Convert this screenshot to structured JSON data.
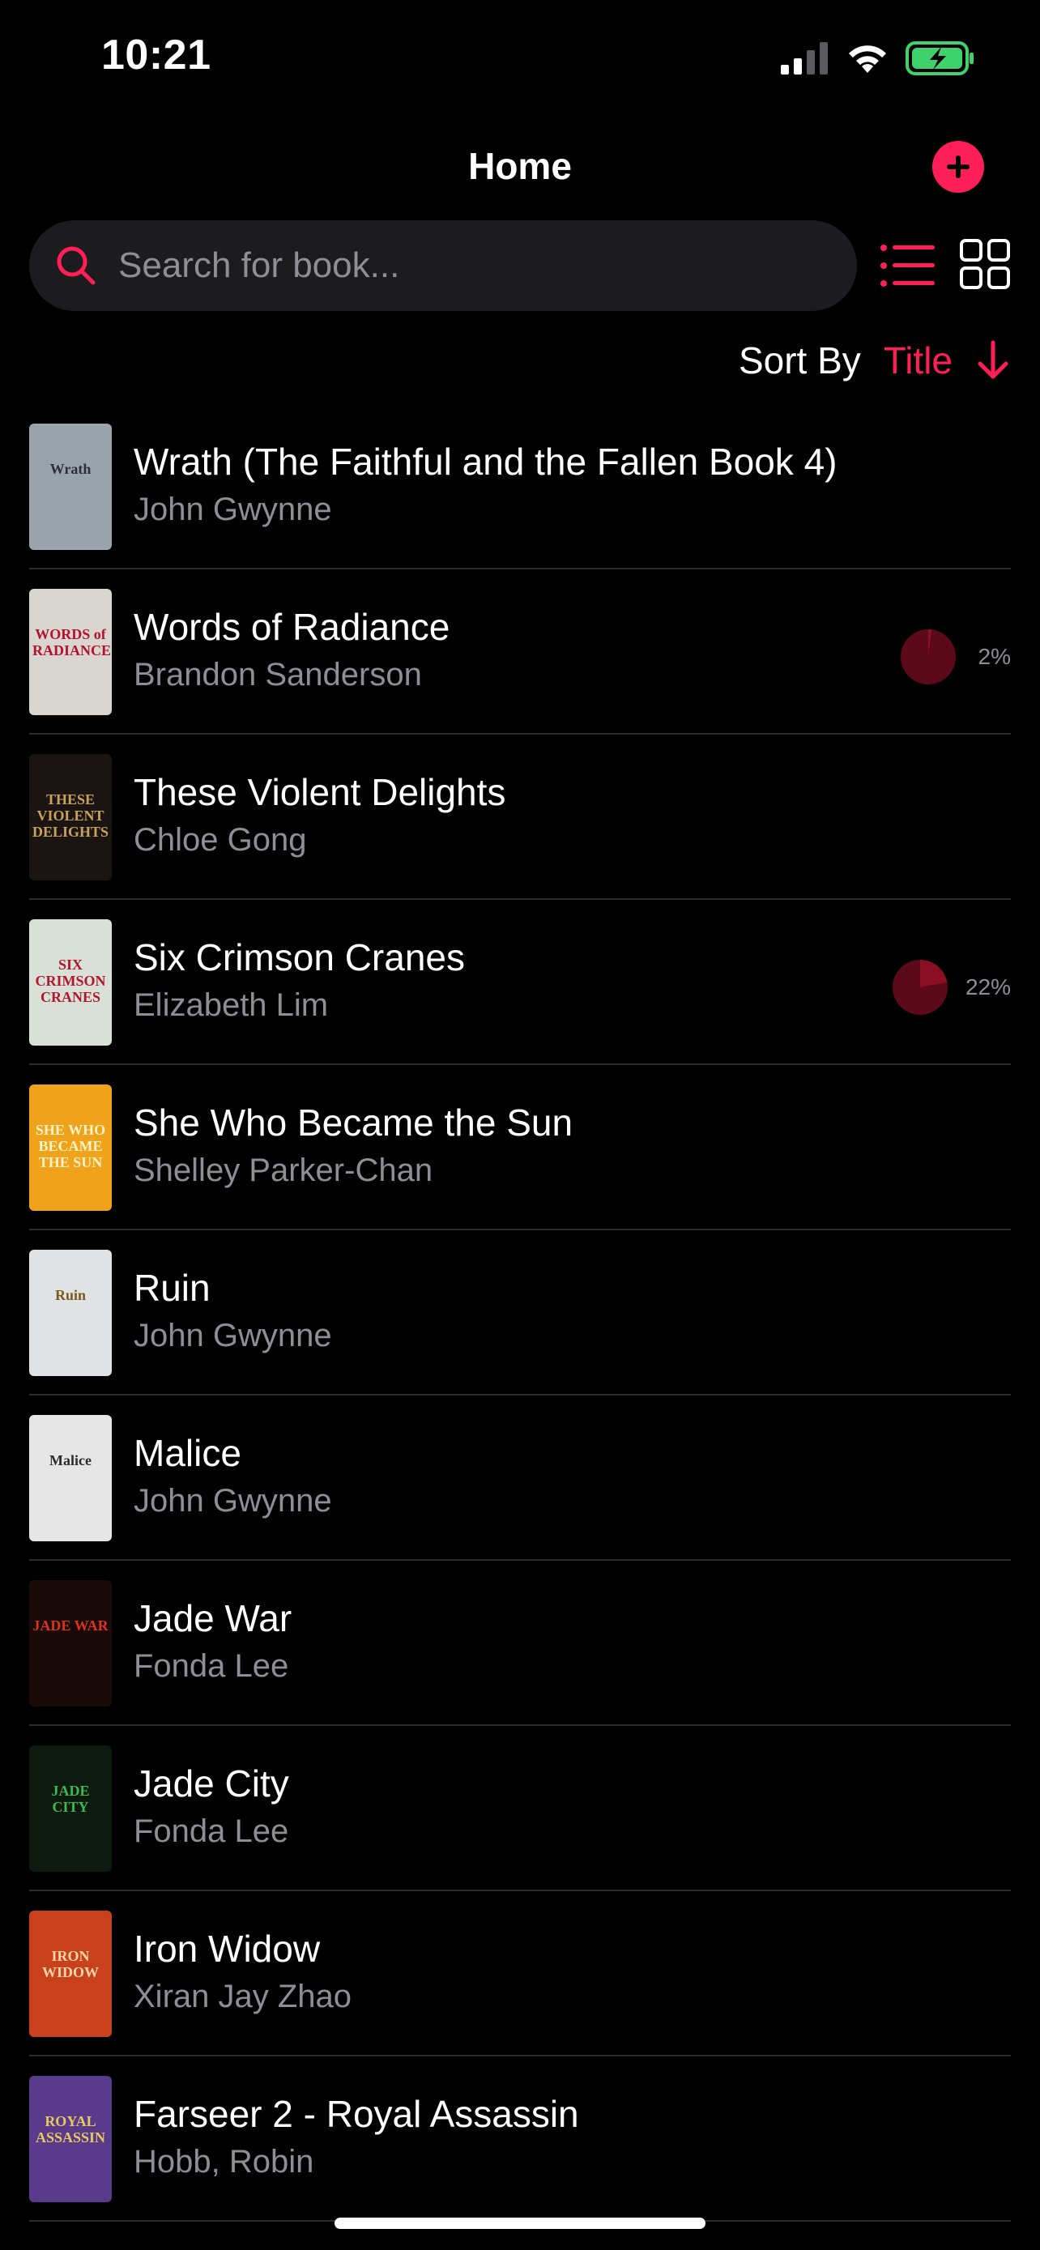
{
  "status_bar": {
    "time": "10:21",
    "icons": [
      "cellular-signal-icon",
      "wifi-icon",
      "battery-charging-icon"
    ]
  },
  "header": {
    "title": "Home",
    "add_icon": "plus-icon"
  },
  "search": {
    "placeholder": "Search for book...",
    "value": ""
  },
  "view_toggle": {
    "list_icon": "list-view-icon",
    "grid_icon": "grid-view-icon",
    "active": "list"
  },
  "sort": {
    "label": "Sort By",
    "value": "Title",
    "direction_icon": "arrow-down-icon"
  },
  "colors": {
    "accent": "#ff1f56",
    "progress_fill": "#8a0f24",
    "progress_track": "#5c0a1a",
    "secondary_text": "#8e8e93",
    "separator": "#2c2c2e"
  },
  "books": [
    {
      "title": "Wrath (The Faithful and the Fallen Book 4)",
      "author": "John Gwynne",
      "progress": null,
      "cover_text": "Wrath",
      "cover_bg": "#9aa3ab",
      "cover_fg": "#2a2f36"
    },
    {
      "title": "Words of Radiance",
      "author": "Brandon Sanderson",
      "progress": 2,
      "progress_label": "2%",
      "cover_text": "WORDS of RADIANCE",
      "cover_bg": "#d9d6d2",
      "cover_fg": "#b3122a"
    },
    {
      "title": "These Violent Delights",
      "author": "Chloe Gong",
      "progress": null,
      "cover_text": "THESE VIOLENT DELIGHTS",
      "cover_bg": "#1a1512",
      "cover_fg": "#c9a15a"
    },
    {
      "title": "Six Crimson Cranes",
      "author": "Elizabeth Lim",
      "progress": 22,
      "progress_label": "22%",
      "cover_text": "SIX CRIMSON CRANES",
      "cover_bg": "#d8e0d8",
      "cover_fg": "#b1162a"
    },
    {
      "title": "She Who Became the Sun",
      "author": "Shelley Parker-Chan",
      "progress": null,
      "cover_text": "SHE WHO BECAME THE SUN",
      "cover_bg": "#f0a21a",
      "cover_fg": "#fff3c8"
    },
    {
      "title": "Ruin",
      "author": "John Gwynne",
      "progress": null,
      "cover_text": "Ruin",
      "cover_bg": "#dfe3e6",
      "cover_fg": "#7a5a1a"
    },
    {
      "title": "Malice",
      "author": "John Gwynne",
      "progress": null,
      "cover_text": "Malice",
      "cover_bg": "#e6e6e6",
      "cover_fg": "#2b2b2b"
    },
    {
      "title": "Jade War",
      "author": "Fonda Lee",
      "progress": null,
      "cover_text": "JADE WAR",
      "cover_bg": "#1a0a08",
      "cover_fg": "#e0301e"
    },
    {
      "title": "Jade City",
      "author": "Fonda Lee",
      "progress": null,
      "cover_text": "JADE CITY",
      "cover_bg": "#0c1a10",
      "cover_fg": "#3fb94a"
    },
    {
      "title": "Iron Widow",
      "author": "Xiran Jay Zhao",
      "progress": null,
      "cover_text": "IRON WIDOW",
      "cover_bg": "#c8401c",
      "cover_fg": "#ffd6a8"
    },
    {
      "title": "Farseer 2 - Royal Assassin",
      "author": "Hobb, Robin",
      "progress": null,
      "cover_text": "ROYAL ASSASSIN",
      "cover_bg": "#5a3a8a",
      "cover_fg": "#e8c860"
    }
  ]
}
